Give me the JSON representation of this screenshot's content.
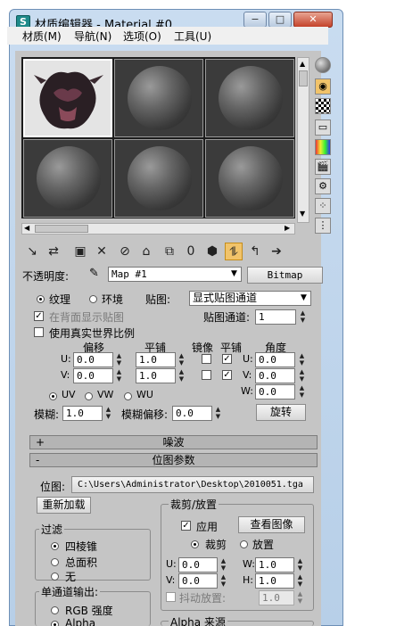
{
  "window": {
    "title": "材质编辑器 - Material #0"
  },
  "titlebar_buttons": {
    "minimize": "−",
    "maximize": "□",
    "close": "✕"
  },
  "menubar": [
    "材质(M)",
    "导航(N)",
    "选项(O)",
    "工具(U)"
  ],
  "slots": [
    {
      "name": "slot-1",
      "active": true
    },
    {
      "name": "slot-2",
      "active": false
    },
    {
      "name": "slot-3",
      "active": false
    },
    {
      "name": "slot-4",
      "active": false
    },
    {
      "name": "slot-5",
      "active": false
    },
    {
      "name": "slot-6",
      "active": false
    }
  ],
  "opacity": {
    "label": "不透明度:",
    "map_name": "Map #1",
    "map_type": "Bitmap"
  },
  "coordinates": {
    "texture_label": "纹理",
    "environ_label": "环境",
    "mapping_label": "贴图:",
    "mapping_value": "显式贴图通道",
    "show_back_label": "在背面显示贴图",
    "realworld_label": "使用真实世界比例",
    "channel_label": "贴图通道:",
    "channel_value": "1",
    "headers": {
      "offset": "偏移",
      "tiling": "平铺",
      "mirror": "镜像",
      "tile": "平铺",
      "angle": "角度"
    },
    "u_offset": "0.0",
    "v_offset": "0.0",
    "u_tiling": "1.0",
    "v_tiling": "1.0",
    "u_angle": "0.0",
    "v_angle": "0.0",
    "w_angle": "0.0",
    "uv": "UV",
    "vw": "VW",
    "wu": "WU",
    "blur_label": "模糊:",
    "blur_value": "1.0",
    "blur_offset_label": "模糊偏移:",
    "blur_offset_value": "0.0",
    "rotate_label": "旋转"
  },
  "rollouts": {
    "noise": "噪波",
    "bitmap_params": "位图参数"
  },
  "bitmap": {
    "path_label": "位图:",
    "path_value": "C:\\Users\\Administrator\\Desktop\\2010051.tga",
    "reload_label": "重新加载",
    "crop_title": "裁剪/放置",
    "apply_label": "应用",
    "view_image_label": "查看图像",
    "crop_label": "裁剪",
    "place_label": "放置",
    "u_value": "0.0",
    "v_value": "0.0",
    "w_value": "1.0",
    "h_value": "1.0",
    "jitter_label": "抖动放置:",
    "jitter_value": "1.0",
    "filter_title": "过滤",
    "filter_pyramidal": "四棱锥",
    "filter_summed": "总面积",
    "filter_none": "无",
    "mono_title": "单通道输出:",
    "mono_rgb": "RGB 强度",
    "mono_alpha": "Alpha",
    "alpha_source_title": "Alpha 来源"
  },
  "labels": {
    "u": "U:",
    "v": "V:",
    "w": "W:",
    "h": "H:"
  }
}
